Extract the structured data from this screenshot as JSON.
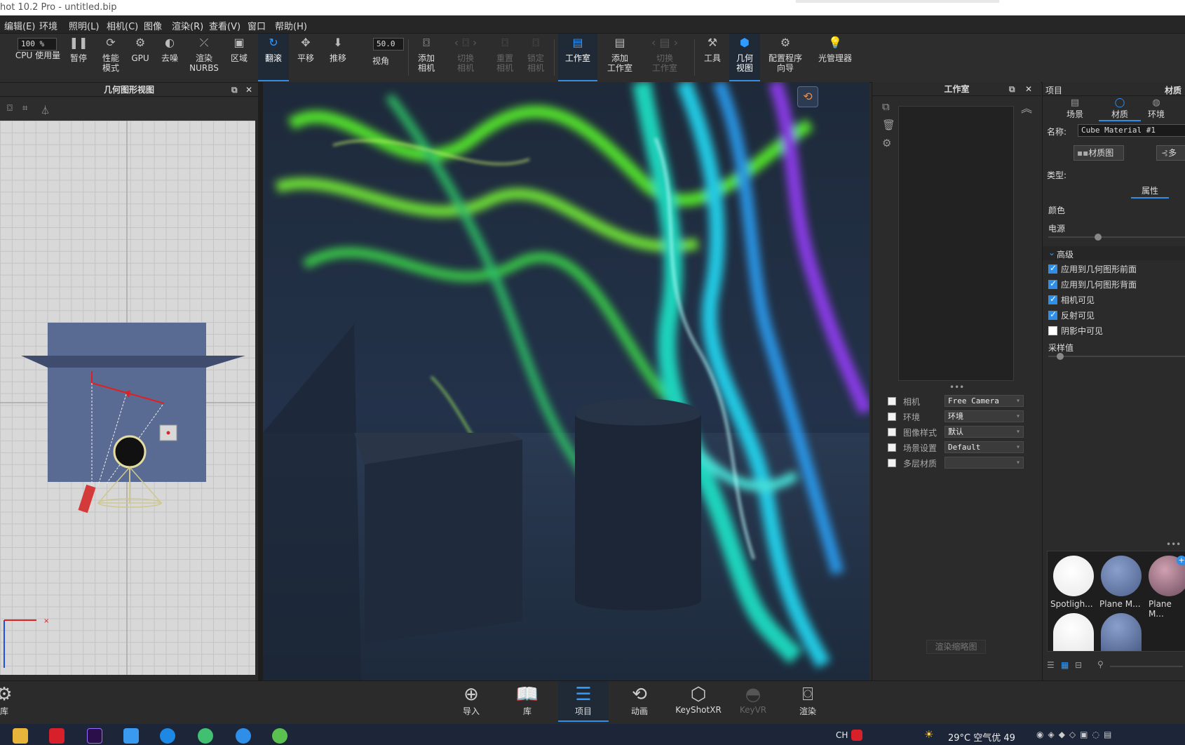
{
  "window": {
    "title": "hot 10.2 Pro  -  untitled.bip"
  },
  "menu": [
    "编辑(E)",
    "环境",
    "照明(L)",
    "相机(C)",
    "图像",
    "渲染(R)",
    "查看(V)",
    "窗口",
    "帮助(H)"
  ],
  "toolbar": {
    "zoom_value": "100 %",
    "fov_value": "50.0",
    "items": {
      "cpu": "CPU 使用量",
      "pause": "暂停",
      "perf1": "性能",
      "perf2": "模式",
      "gpu": "GPU",
      "denoise": "去噪",
      "nurbs1": "渲染",
      "nurbs2": "NURBS",
      "region": "区域",
      "tumble": "翻滚",
      "pan": "平移",
      "dolly": "推移",
      "fov": "视角",
      "addcam1": "添加",
      "addcam2": "相机",
      "switchcam1": "切换",
      "switchcam2": "相机",
      "resetcam1": "重置",
      "resetcam2": "相机",
      "lockcam1": "锁定",
      "lockcam2": "相机",
      "studio": "工作室",
      "addstudio1": "添加",
      "addstudio2": "工作室",
      "switchstudio1": "切换",
      "switchstudio2": "工作室",
      "tools": "工具",
      "geo1": "几何",
      "geo2": "视图",
      "config1": "配置程序",
      "config2": "向导",
      "lightmgr": "光管理器"
    }
  },
  "geometry_panel": {
    "title": "几何图形视图"
  },
  "studio_panel": {
    "title": "工作室",
    "rows": [
      {
        "label": "相机",
        "value": "Free Camera"
      },
      {
        "label": "环境",
        "value": "环境"
      },
      {
        "label": "图像样式",
        "value": "默认"
      },
      {
        "label": "场景设置",
        "value": "Default"
      },
      {
        "label": "多层材质",
        "value": ""
      }
    ],
    "render_thumb": "渲染缩略图"
  },
  "project_panel": {
    "title": "项目",
    "title_right": "材质",
    "tabs": [
      "场景",
      "材质",
      "环境"
    ],
    "name_label": "名称:",
    "name_value": "Cube Material #1",
    "material_graph": "材质图",
    "multi": "多",
    "type_label": "类型:",
    "properties_tab": "属性",
    "color_label": "颜色",
    "power_label": "电源",
    "advanced": "高级",
    "checks": [
      {
        "label": "应用到几何图形前面",
        "checked": true
      },
      {
        "label": "应用到几何图形背面",
        "checked": true
      },
      {
        "label": "相机可见",
        "checked": true
      },
      {
        "label": "反射可见",
        "checked": true
      },
      {
        "label": "阴影中可见",
        "checked": false
      }
    ],
    "samples_label": "采样值",
    "materials": [
      "Spotligh...",
      "Plane M...",
      "Plane M..."
    ]
  },
  "bottom": {
    "library_left": "库",
    "items": [
      "导入",
      "库",
      "项目",
      "动画",
      "KeyShotXR",
      "KeyVR",
      "渲染"
    ]
  },
  "taskbar": {
    "lang": "CH",
    "weather": "29°C  空气优 49"
  },
  "colors": {
    "accent": "#2f8ee8",
    "panel": "#2b2b2b",
    "dark": "#1a1a1a"
  }
}
